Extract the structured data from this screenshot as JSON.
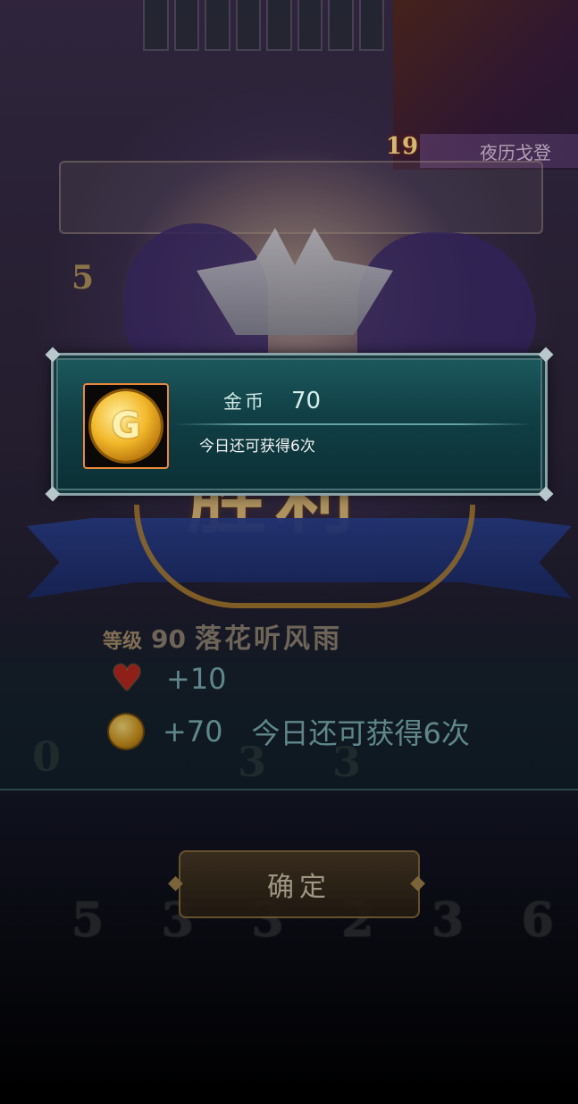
{
  "opponent": {
    "level": "19",
    "name": "夜历戈登"
  },
  "background": {
    "left_number": "5",
    "victory_text": "胜利",
    "card_numbers_mid": [
      "0",
      "3",
      "3"
    ],
    "card_numbers_bottom": [
      "5",
      "3",
      "3",
      "2",
      "3",
      "6"
    ]
  },
  "result": {
    "level_label": "等级",
    "level_value": "90",
    "player_name": "落花听风雨",
    "heart_reward": "+10",
    "coin_reward": "+70",
    "daily_remaining": "今日还可获得6次",
    "heart_icon": "heart-icon",
    "coin_icon": "gold-coin-icon"
  },
  "confirm": {
    "label": "确定"
  },
  "popup": {
    "item_name": "金币",
    "item_amount": "70",
    "note": "今日还可获得6次",
    "icon": "gold-coin-icon",
    "icon_glyph": "G",
    "frame_color": "#e8893a"
  }
}
